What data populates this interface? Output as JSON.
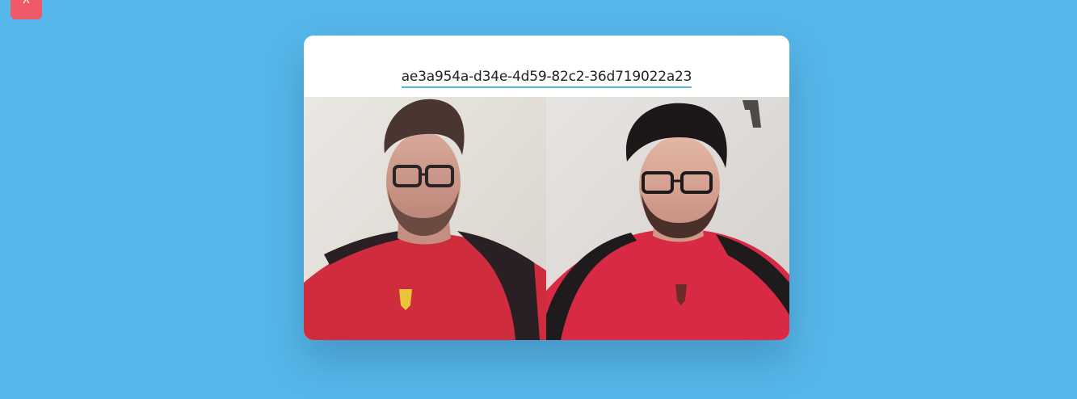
{
  "close_button": {
    "label": "X"
  },
  "call": {
    "room_id": "ae3a954a-d34e-4d59-82c2-36d719022a23"
  },
  "colors": {
    "background": "#56b7ea",
    "card": "#ffffff",
    "close_button": "#ee5a67",
    "underline": "#56b7ea"
  },
  "videos": [
    {
      "name": "local-video"
    },
    {
      "name": "remote-video"
    }
  ]
}
